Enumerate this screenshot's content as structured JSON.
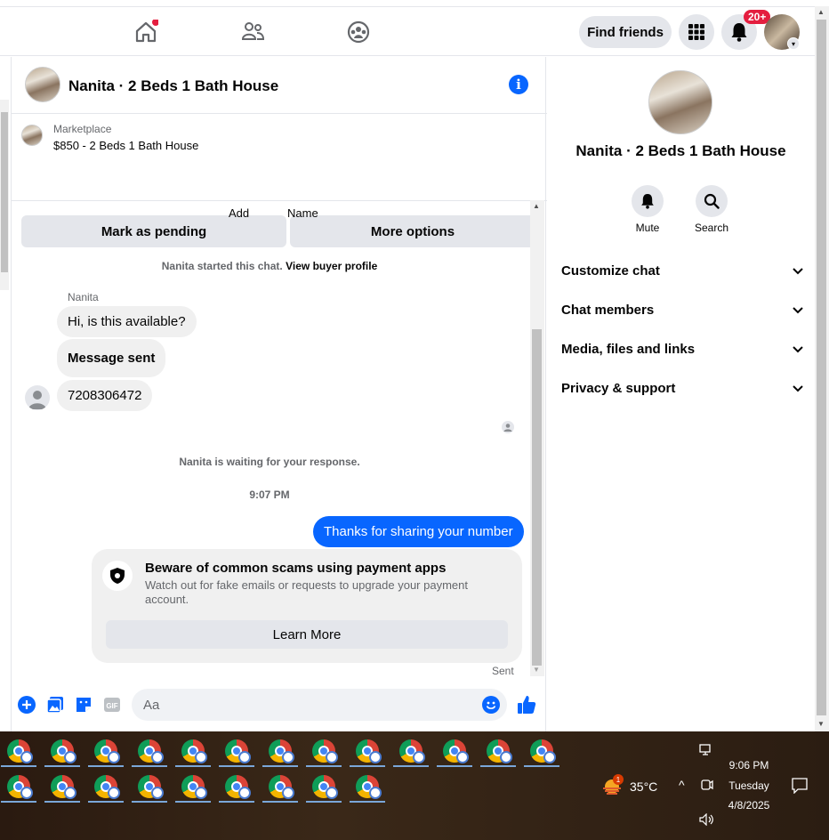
{
  "nav": {
    "find_friends": "Find friends",
    "notif_badge": "20+"
  },
  "chat": {
    "title": "Nanita · 2 Beds 1 Bath House",
    "marketplace_label": "Marketplace",
    "listing": "$850 - 2 Beds 1 Bath House",
    "mark_pending": "Mark as pending",
    "more_options": "More options",
    "action_add": "Add",
    "action_name": "Name",
    "started_text": "Nanita started this chat.",
    "view_buyer": "View buyer profile",
    "sender_name": "Nanita",
    "messages": [
      "Hi, is this available?",
      "Message sent",
      "7208306472"
    ],
    "waiting": "Nanita is waiting for your response.",
    "time": "9:07 PM",
    "my_message": "Thanks for sharing your number",
    "scam_title": "Beware of common scams using payment apps",
    "scam_body": "Watch out for fake emails or requests to upgrade your payment account.",
    "learn_more": "Learn More",
    "sent": "Sent",
    "input_placeholder": "Aa"
  },
  "panel": {
    "title": "Nanita · 2 Beds 1 Bath House",
    "mute": "Mute",
    "search": "Search",
    "items": [
      "Customize chat",
      "Chat members",
      "Media, files and links",
      "Privacy & support"
    ]
  },
  "taskbar": {
    "temp": "35°C",
    "weather_badge": "1",
    "time": "9:06 PM",
    "day": "Tuesday",
    "date": "4/8/2025"
  },
  "colors": {
    "accent": "#0866ff",
    "bubble": "#f0f0f0",
    "button": "#e4e6eb"
  }
}
